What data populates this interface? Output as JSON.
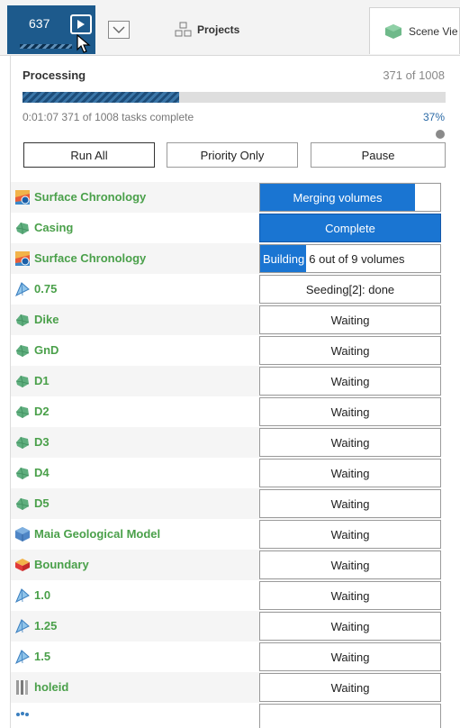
{
  "toolbar": {
    "counter": "637",
    "projects_label": "Projects",
    "scene_tab_label": "Scene Vie"
  },
  "processing": {
    "title": "Processing",
    "count": "371 of 1008",
    "progress_fraction": 0.37,
    "elapsed": "0:01:07",
    "tasks_text": "371 of 1008 tasks complete",
    "percent": "37%",
    "buttons": {
      "run_all": "Run All",
      "priority_only": "Priority Only",
      "pause": "Pause"
    }
  },
  "rows": [
    {
      "label": "Surface Chronology",
      "icon": "surface-chronology-icon",
      "status": "Merging volumes",
      "state": "partial",
      "fraction": 0.86
    },
    {
      "label": "Casing",
      "icon": "surface-icon",
      "status": "Complete",
      "state": "full"
    },
    {
      "label": "Surface Chronology",
      "icon": "surface-chronology-icon",
      "chip": "Building",
      "status": "6 out of 9 volumes",
      "state": "building"
    },
    {
      "label": "0.75",
      "icon": "isosurface-icon",
      "status": "Seeding[2]: done",
      "state": "waiting"
    },
    {
      "label": "Dike",
      "icon": "surface-icon",
      "status": "Waiting",
      "state": "waiting"
    },
    {
      "label": "GnD",
      "icon": "surface-icon",
      "status": "Waiting",
      "state": "waiting"
    },
    {
      "label": "D1",
      "icon": "surface-icon",
      "status": "Waiting",
      "state": "waiting"
    },
    {
      "label": "D2",
      "icon": "surface-icon",
      "status": "Waiting",
      "state": "waiting"
    },
    {
      "label": "D3",
      "icon": "surface-icon",
      "status": "Waiting",
      "state": "waiting"
    },
    {
      "label": "D4",
      "icon": "surface-icon",
      "status": "Waiting",
      "state": "waiting"
    },
    {
      "label": "D5",
      "icon": "surface-icon",
      "status": "Waiting",
      "state": "waiting"
    },
    {
      "label": "Maia Geological Model",
      "icon": "geological-model-icon",
      "status": "Waiting",
      "state": "waiting"
    },
    {
      "label": "Boundary",
      "icon": "boundary-icon",
      "status": "Waiting",
      "state": "waiting"
    },
    {
      "label": "1.0",
      "icon": "isosurface-icon",
      "status": "Waiting",
      "state": "waiting"
    },
    {
      "label": "1.25",
      "icon": "isosurface-icon",
      "status": "Waiting",
      "state": "waiting"
    },
    {
      "label": "1.5",
      "icon": "isosurface-icon",
      "status": "Waiting",
      "state": "waiting"
    },
    {
      "label": "holeid",
      "icon": "drillhole-icon",
      "status": "Waiting",
      "state": "waiting"
    },
    {
      "label": "",
      "icon": "points-icon",
      "status": "",
      "state": "waiting"
    }
  ],
  "colors": {
    "accent": "#1a75d2",
    "label_green": "#4aa04a",
    "counter_bg": "#1d5a8c"
  }
}
